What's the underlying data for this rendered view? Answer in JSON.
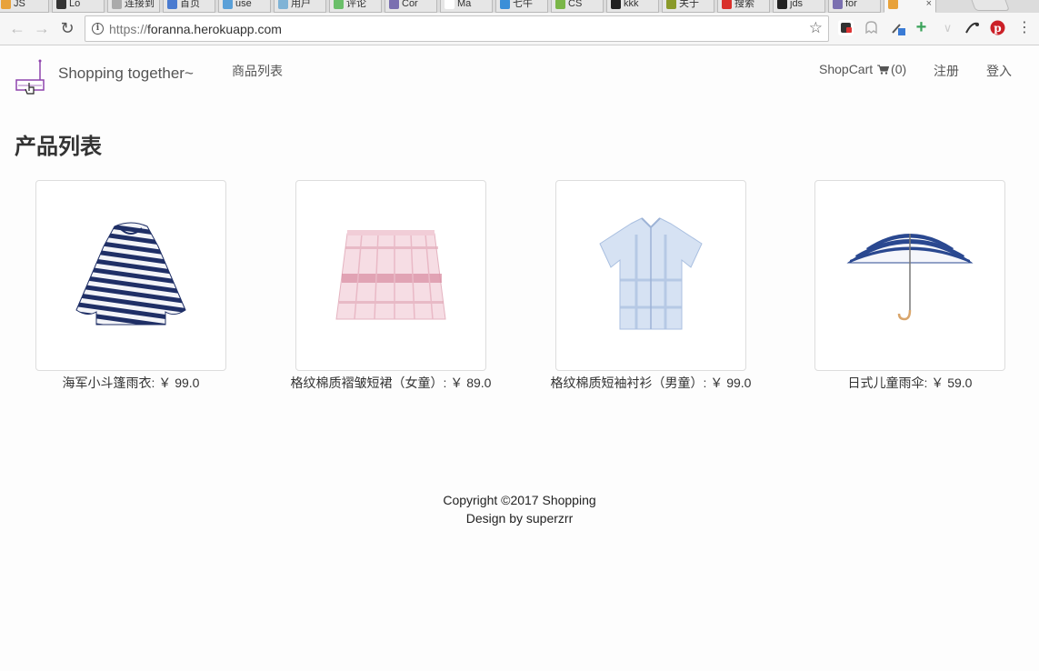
{
  "browser": {
    "tabs": [
      {
        "label": "JS",
        "color": "#e8a23a"
      },
      {
        "label": "Lo",
        "color": "#333333"
      },
      {
        "label": "连接到",
        "color": "#aaaaaa"
      },
      {
        "label": "首页",
        "color": "#4a7bd0"
      },
      {
        "label": "use",
        "color": "#5aa0d8"
      },
      {
        "label": "用户",
        "color": "#7fb3d6"
      },
      {
        "label": "评论",
        "color": "#6abf69"
      },
      {
        "label": "Cor",
        "color": "#7a6fb0"
      },
      {
        "label": "Ma",
        "color": "#ffffff"
      },
      {
        "label": "七牛",
        "color": "#3a8fd8"
      },
      {
        "label": "CS",
        "color": "#7ab648"
      },
      {
        "label": "kkk",
        "color": "#222222"
      },
      {
        "label": "关于",
        "color": "#8a9a2a"
      },
      {
        "label": "搜索",
        "color": "#d9302a"
      },
      {
        "label": "jds",
        "color": "#222222"
      },
      {
        "label": "for",
        "color": "#7a6fb0"
      },
      {
        "label": "",
        "color": "#e8a23a"
      }
    ],
    "url_protocol": "https://",
    "url_host": "foranna.herokuapp.com"
  },
  "navbar": {
    "brand": "Shopping together~",
    "products_link": "商品列表",
    "cart_label": "ShopCart",
    "cart_count": "(0)",
    "register": "注册",
    "login": "登入"
  },
  "main": {
    "title": "产品列表",
    "products": [
      {
        "caption": "海军小斗篷雨衣: ￥ 99.0",
        "image": "striped-rain-cape"
      },
      {
        "caption": "格纹棉质褶皱短裙（女童）: ￥ 89.0",
        "image": "pink-plaid-skirt"
      },
      {
        "caption": "格纹棉质短袖衬衫（男童）: ￥ 99.0",
        "image": "blue-plaid-shirt"
      },
      {
        "caption": "日式儿童雨伞: ￥ 59.0",
        "image": "striped-umbrella"
      }
    ]
  },
  "footer": {
    "copyright": "Copyright ©2017 Shopping",
    "credit": "Design by superzrr"
  }
}
